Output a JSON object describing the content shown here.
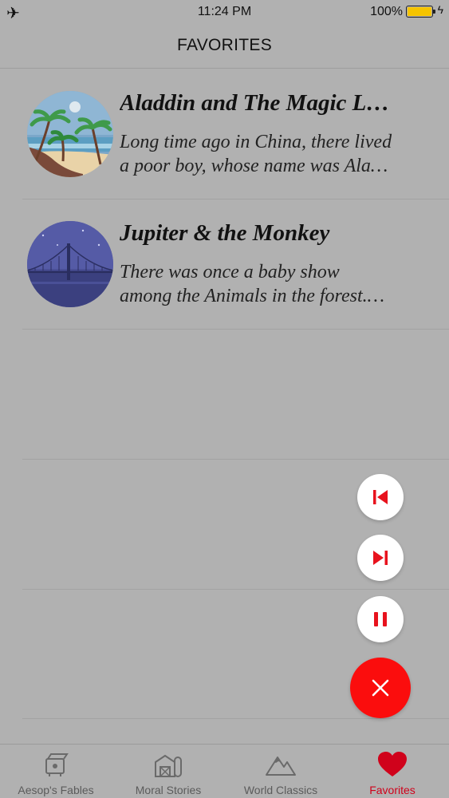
{
  "status": {
    "time": "11:24 PM",
    "battery_percent": "100%",
    "battery_level": 1.0,
    "icons": [
      "airplane-mode-icon",
      "battery-icon",
      "charging-bolt-icon"
    ]
  },
  "header": {
    "title": "FAVORITES"
  },
  "stories": [
    {
      "title": "Aladdin and The Magic L…",
      "desc_line1": "Long time ago in China, there lived",
      "desc_line2": "a poor boy, whose name was Ala…",
      "thumbnail": "palm-beach-illustration"
    },
    {
      "title": "Jupiter & the Monkey",
      "desc_line1": "There was once a baby show",
      "desc_line2": "among the Animals in the forest.…",
      "thumbnail": "night-bridge-illustration"
    }
  ],
  "player": {
    "controls": [
      "previous-track",
      "next-track",
      "pause",
      "close"
    ],
    "accent_color": "#fb0d0d"
  },
  "tabs": [
    {
      "label": "Aesop's Fables",
      "icon": "aesop-icon",
      "active": false
    },
    {
      "label": "Moral Stories",
      "icon": "barn-icon",
      "active": false
    },
    {
      "label": "World Classics",
      "icon": "mountains-icon",
      "active": false
    },
    {
      "label": "Favorites",
      "icon": "heart-icon",
      "active": true
    }
  ],
  "colors": {
    "background": "#b1b1b1",
    "active_tab": "#d0021b"
  }
}
